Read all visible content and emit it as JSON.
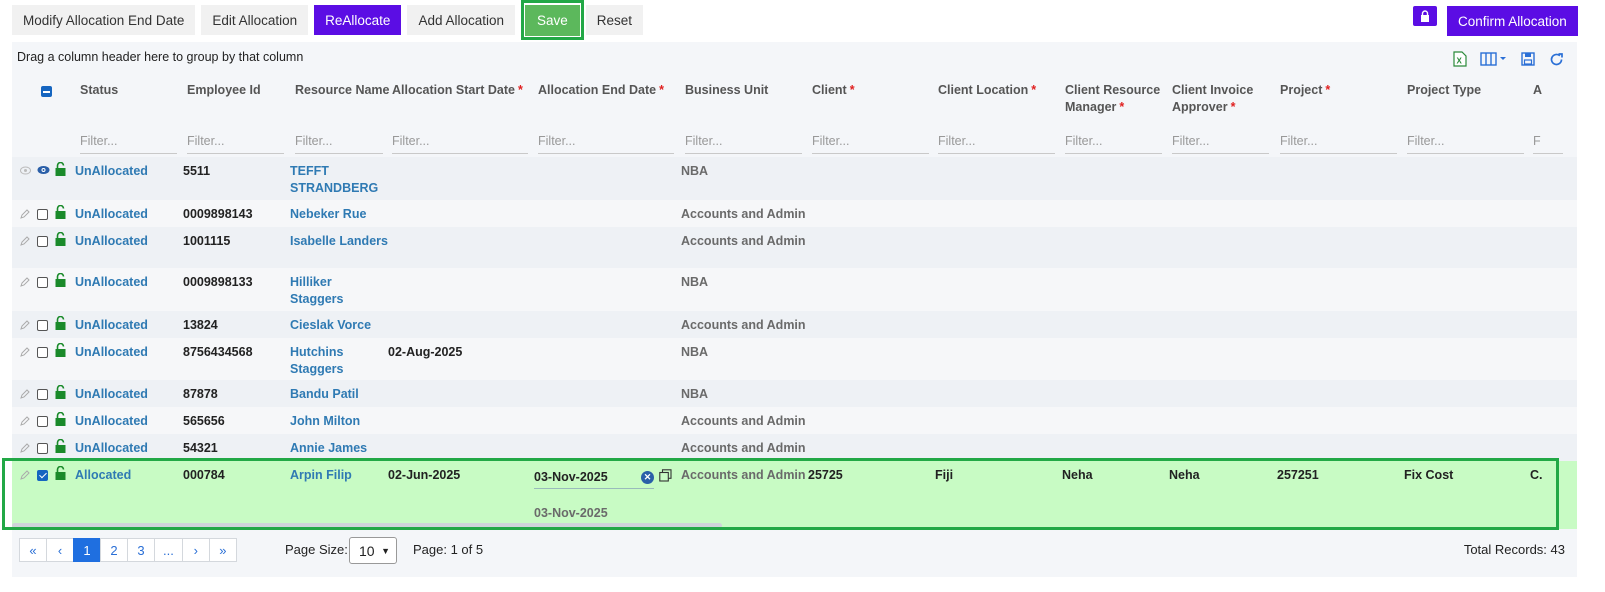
{
  "toolbar": {
    "buttons": [
      "Modify Allocation End Date",
      "Edit Allocation",
      "ReAllocate",
      "Add Allocation",
      "Save",
      "Reset"
    ],
    "confirm": "Confirm Allocation"
  },
  "grid": {
    "group_hint": "Drag a column header here to group by that column",
    "filter_placeholder": "Filter...",
    "columns": {
      "status": "Status",
      "employee_id": "Employee Id",
      "resource_name": "Resource Name",
      "alloc_start": "Allocation Start Date",
      "alloc_end": "Allocation End Date",
      "business_unit": "Business Unit",
      "client": "Client",
      "client_location": "Client Location",
      "client_resource_manager_1": "Client Resource",
      "client_resource_manager_2": "Manager",
      "client_invoice_approver_1": "Client Invoice",
      "client_invoice_approver_2": "Approver",
      "project": "Project",
      "project_type": "Project Type",
      "more": "A"
    },
    "rows": [
      {
        "status": "UnAllocated",
        "emp": "5511",
        "name1": "TEFFT",
        "name2": "STRANDBERG",
        "start": "",
        "bu": "NBA"
      },
      {
        "status": "UnAllocated",
        "emp": "0009898143",
        "name1": "Nebeker Rue",
        "name2": "",
        "start": "",
        "bu": "Accounts and Admin"
      },
      {
        "status": "UnAllocated",
        "emp": "1001115",
        "name1": "Isabelle Landers",
        "name2": "",
        "start": "",
        "bu": "Accounts and Admin"
      },
      {
        "status": "UnAllocated",
        "emp": "0009898133",
        "name1": "Hilliker",
        "name2": "Staggers",
        "start": "",
        "bu": "NBA"
      },
      {
        "status": "UnAllocated",
        "emp": "13824",
        "name1": "Cieslak Vorce",
        "name2": "",
        "start": "",
        "bu": "Accounts and Admin"
      },
      {
        "status": "UnAllocated",
        "emp": "8756434568",
        "name1": "Hutchins",
        "name2": "Staggers",
        "start": "02-Aug-2025",
        "bu": "NBA"
      },
      {
        "status": "UnAllocated",
        "emp": "87878",
        "name1": "Bandu Patil",
        "name2": "",
        "start": "",
        "bu": "NBA"
      },
      {
        "status": "UnAllocated",
        "emp": "565656",
        "name1": "John Milton",
        "name2": "",
        "start": "",
        "bu": "Accounts and Admin"
      },
      {
        "status": "UnAllocated",
        "emp": "54321",
        "name1": "Annie James",
        "name2": "",
        "start": "",
        "bu": "Accounts and Admin"
      }
    ],
    "selected_row": {
      "status": "Allocated",
      "emp": "000784",
      "name": "Arpin Filip",
      "start": "02-Jun-2025",
      "end_input": "03-Nov-2025",
      "end_below": "03-Nov-2025",
      "bu": "Accounts and Admin",
      "client": "25725",
      "client_location": "Fiji",
      "client_resource_manager": "Neha",
      "client_invoice_approver": "Neha",
      "project": "257251",
      "project_type": "Fix Cost",
      "more": "C."
    }
  },
  "pager": {
    "first": "«",
    "prev": "‹",
    "pages": [
      "1",
      "2",
      "3",
      "..."
    ],
    "next": "›",
    "last": "»",
    "page_size_label": "Page Size:",
    "page_size": "10",
    "page_info": "Page: 1 of 5",
    "total": "Total Records: 43"
  },
  "colors": {
    "accent": "#5b0de4",
    "save": "#5cb85c",
    "highlight": "#22a846",
    "link": "#2f7ab3",
    "selected_row": "#c8fbc4"
  }
}
